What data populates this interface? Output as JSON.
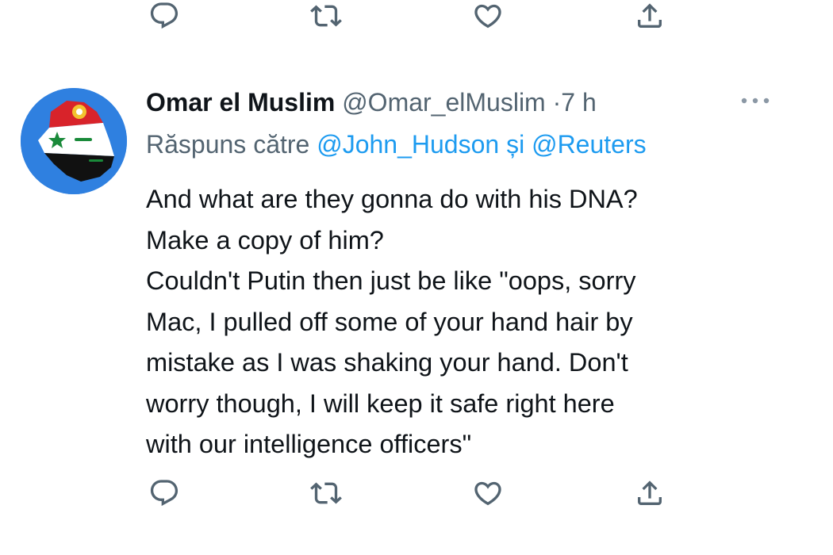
{
  "tweet": {
    "display_name": "Omar el Muslim",
    "handle": "@Omar_elMuslim",
    "separator": "·",
    "time": "7 h",
    "replying_prefix": "Răspuns către",
    "mention_1": "@John_Hudson",
    "conjunction": "și",
    "mention_2": "@Reuters",
    "text_lines": [
      "And what are they gonna do with his DNA?",
      "Make a copy of him?",
      "Couldn't Putin then just be like \"oops, sorry",
      "Mac, I pulled off some of your hand hair by",
      "mistake as I was shaking your hand. Don't",
      "worry though, I will keep it safe right here",
      "with our intelligence officers\""
    ]
  },
  "actions": [
    "reply-icon",
    "retweet-icon",
    "like-icon",
    "share-icon"
  ],
  "colors": {
    "text": "#0f1419",
    "secondary": "#536471",
    "link": "#1d9bf0",
    "icon": "#536471"
  }
}
